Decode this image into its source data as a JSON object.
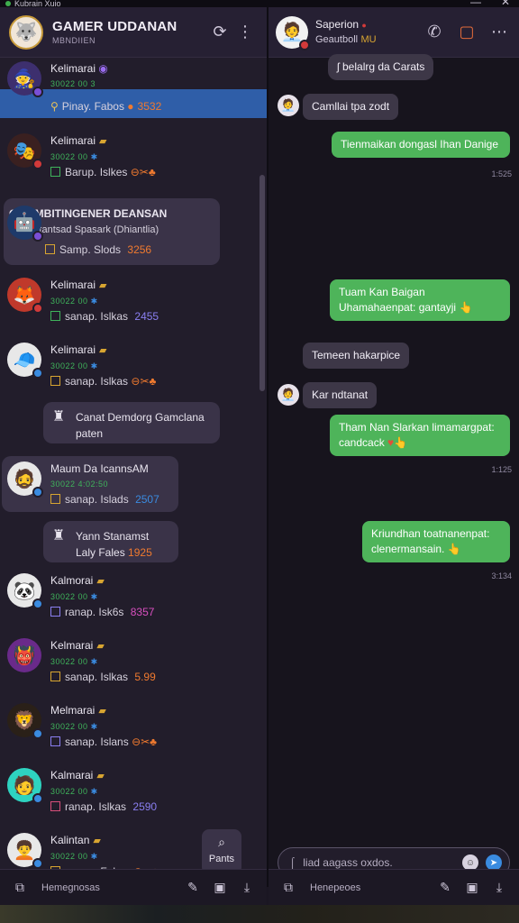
{
  "window": {
    "title": "Kubrain Xuio"
  },
  "left": {
    "header": {
      "title": "GAMER UDDANAN",
      "subtitle": "MBNDIIEN"
    },
    "chats": [
      {
        "name": "Kelimarai",
        "meta": "30022 00 3",
        "last": "Pinay. Fabos",
        "extra": "3532",
        "avatar": "🧙",
        "avbg": "#3d2f6e"
      },
      {
        "name": "Kelimarai",
        "meta": "30022 00",
        "last": "Barup. Islkes",
        "extra": "",
        "avatar": "🎭",
        "avbg": "#3a2020"
      },
      {
        "name": "Kelimarai",
        "meta": "30022 00",
        "last": "sanap. Islkas",
        "extra": "2455",
        "avatar": "🦊",
        "avbg": "#c0392b"
      },
      {
        "name": "Kelimarai",
        "meta": "30022 00",
        "last": "sanap. Islkas",
        "extra": "",
        "avatar": "🧢",
        "avbg": "#e8e8e8"
      },
      {
        "name": "Maum Da IcannsAM",
        "meta": "30022 4:02:50",
        "last": "sanap. Islads",
        "extra": "2507",
        "avatar": "🧔",
        "avbg": "#e8e8e8"
      },
      {
        "name": "Kalmorai",
        "meta": "30022 00",
        "last": "ranap. Isk6s",
        "extra": "8357",
        "avatar": "🐼",
        "avbg": "#e8e8e8"
      },
      {
        "name": "Kelmarai",
        "meta": "30022 00",
        "last": "sanap. Islkas",
        "extra": "5.99",
        "avatar": "👹",
        "avbg": "#6a2a8a"
      },
      {
        "name": "Melmarai",
        "meta": "30022 00",
        "last": "sanap. Islans",
        "extra": "",
        "avatar": "🦁",
        "avbg": "#2a2018"
      },
      {
        "name": "Kalmarai",
        "meta": "30022 00",
        "last": "ranap. Islkas",
        "extra": "2590",
        "avatar": "🧑",
        "avbg": "#2ed3c0"
      },
      {
        "name": "Kalintan",
        "meta": "30022 00",
        "last": "sanap. Fabos",
        "extra": "",
        "avatar": "🧑‍🦱",
        "avbg": "#e8e8e8"
      }
    ],
    "group_card": {
      "title": "GOMMBITINGENER DEANSAN",
      "desc": "Vin lehtantsad Spasark (Dhiantlia)",
      "last": "Samp. Slods",
      "extra": "3256",
      "avatar": "🤖"
    },
    "card1": {
      "line1": "Canat Demdorg Gamclana",
      "line2": "paten"
    },
    "card2": {
      "line1": "Yann Stanamst",
      "line2": "Laly Fales",
      "extra": "1925"
    },
    "pants_label": "Pants",
    "footer_label": "Hemegnosas"
  },
  "right": {
    "header": {
      "name": "Saperion",
      "sub1": "Geautboll",
      "sub2": "MU"
    },
    "messages": [
      {
        "dir": "in",
        "text": "belalrg da Carats"
      },
      {
        "dir": "in",
        "text": "Camllai tpa zodt"
      },
      {
        "dir": "out",
        "text": "Tienmaikan dongasl Ihan Danige"
      },
      {
        "dir": "out",
        "text": "Tuam Kan Baigan Uhamahaenpat: gantayji"
      },
      {
        "dir": "in",
        "text": "Temeen hakarpice"
      },
      {
        "dir": "in",
        "text": "Kar ndtanat"
      },
      {
        "dir": "out",
        "text": "Tham Nan Slarkan limamargpat: candcack"
      },
      {
        "dir": "out",
        "text": "Kriundhan toatnanenpat: clenermansain."
      }
    ],
    "times": [
      "1:525",
      "1:125",
      "3:134"
    ],
    "composer_placeholder": "liad aagass oxdos.",
    "footer_label": "Henepeoes"
  },
  "colors": {
    "accent_blue": "#2f5ea8",
    "bubble_out": "#4eb45a",
    "bubble_in": "#3d3747"
  }
}
